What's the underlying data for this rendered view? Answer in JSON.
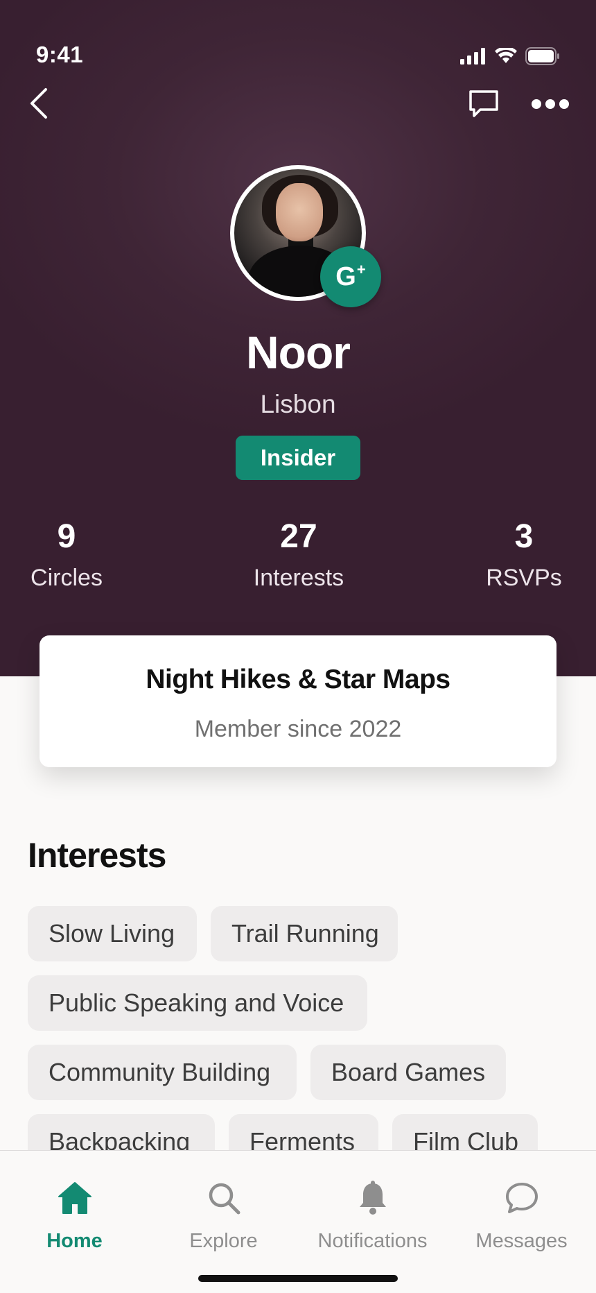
{
  "status_bar": {
    "time": "9:41"
  },
  "profile": {
    "name": "Noor",
    "city": "Lisbon",
    "tier": "Insider",
    "badge_letter": "G",
    "badge_plus": "+"
  },
  "stats": [
    {
      "value": "9",
      "label": "Circles"
    },
    {
      "value": "27",
      "label": "Interests"
    },
    {
      "value": "3",
      "label": "RSVPs"
    }
  ],
  "group_card": {
    "title": "Night Hikes & Star Maps",
    "subtitle": "Member since 2022"
  },
  "interests": {
    "title": "Interests",
    "items": [
      "Slow Living",
      "Trail Running",
      "Public Speaking and Voice",
      "Community Building",
      "Board Games",
      "Backpacking",
      "Ferments",
      "Film Club"
    ]
  },
  "tab_bar": {
    "tabs": [
      {
        "label": "Home",
        "icon": "home-icon",
        "active": true
      },
      {
        "label": "Explore",
        "icon": "search-icon",
        "active": false
      },
      {
        "label": "Notifications",
        "icon": "bell-icon",
        "active": false
      },
      {
        "label": "Messages",
        "icon": "message-icon",
        "active": false
      }
    ]
  },
  "colors": {
    "accent": "#138a72",
    "hero_bg": "#3f2536",
    "page_bg": "#faf9f8"
  }
}
